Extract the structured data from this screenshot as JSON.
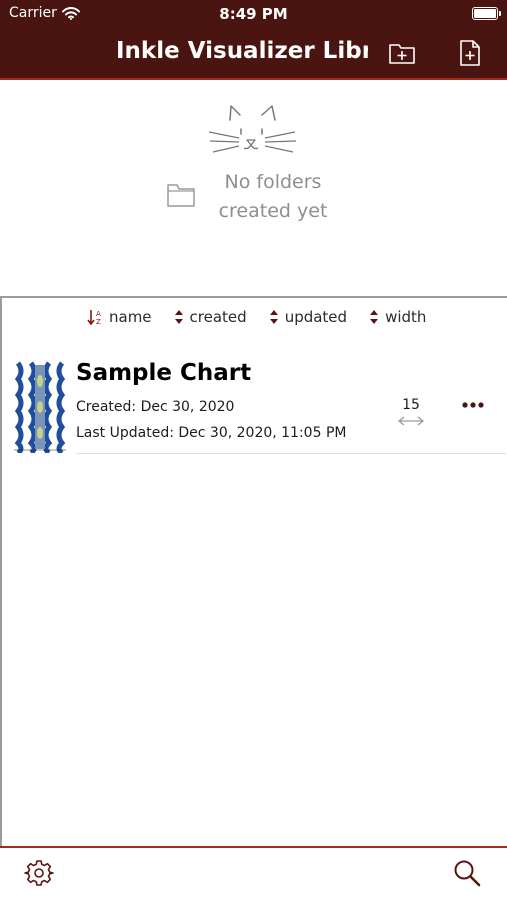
{
  "status_bar": {
    "carrier": "Carrier",
    "time": "8:49 PM"
  },
  "nav": {
    "title": "Inkle Visualizer Libr...",
    "add_folder_icon": "folder-plus-icon",
    "add_chart_icon": "document-plus-icon"
  },
  "folders": {
    "empty_text": "No folders created yet"
  },
  "sort": {
    "options": [
      {
        "label": "name",
        "icon": "sort-az-icon"
      },
      {
        "label": "created",
        "icon": "sort-icon"
      },
      {
        "label": "updated",
        "icon": "sort-icon"
      },
      {
        "label": "width",
        "icon": "sort-icon"
      }
    ]
  },
  "charts": [
    {
      "name": "Sample Chart",
      "created": "Created: Dec 30, 2020",
      "updated": "Last Updated: Dec 30, 2020, 11:05 PM",
      "width": "15"
    }
  ],
  "toolbar": {
    "settings_icon": "gear-icon",
    "search_icon": "search-icon"
  },
  "colors": {
    "accent": "#4a1410",
    "accent_border": "#a52a1c",
    "muted_text": "#8e8e93"
  }
}
